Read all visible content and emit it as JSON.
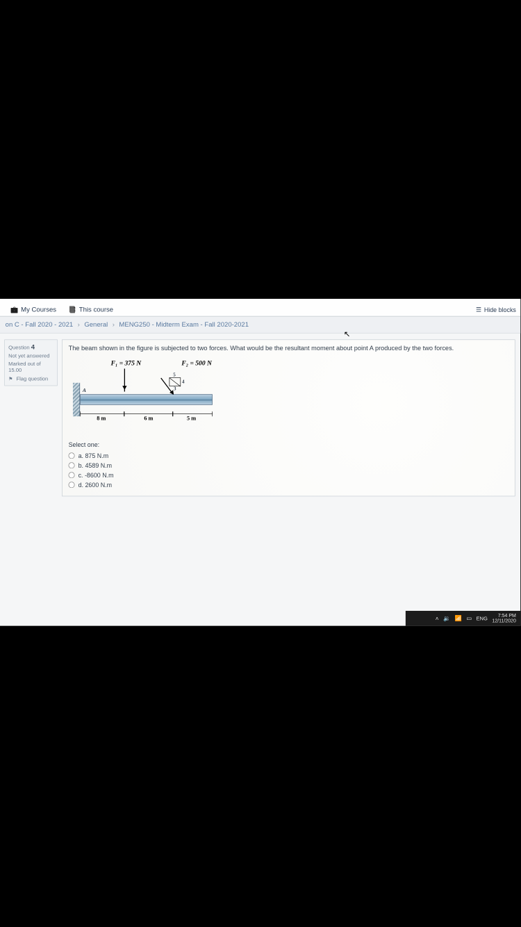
{
  "topbar": {
    "my_courses": "My Courses",
    "this_course": "This course",
    "hide_blocks": "Hide blocks"
  },
  "breadcrumb": {
    "course": "on C - Fall 2020 - 2021",
    "section": "General",
    "exam": "MENG250 - Midterm Exam - Fall 2020-2021"
  },
  "qnav": {
    "label": "Question",
    "number": "4",
    "status": "Not yet answered",
    "marked_label": "Marked out of",
    "marked_value": "15.00",
    "flag": "Flag question"
  },
  "question": {
    "text": "The beam shown in the figure is subjected to two forces. What would be the resultant moment about point A produced by the two forces.",
    "F1": "F₁ = 375 N",
    "F2": "F₂ = 500 N",
    "d1": "8 m",
    "d2": "6 m",
    "d3": "5 m",
    "tri_a": "5",
    "tri_b": "4",
    "tri_c": "3",
    "pointA": "A",
    "select": "Select one:",
    "opts": {
      "a": "a. 875 N.m",
      "b": "b. 4589 N.m",
      "c": "c. -8600 N.m",
      "d": "d. 2600 N.m"
    }
  },
  "taskbar": {
    "lang": "ENG",
    "time": "7:54 PM",
    "date": "12/11/2020"
  }
}
